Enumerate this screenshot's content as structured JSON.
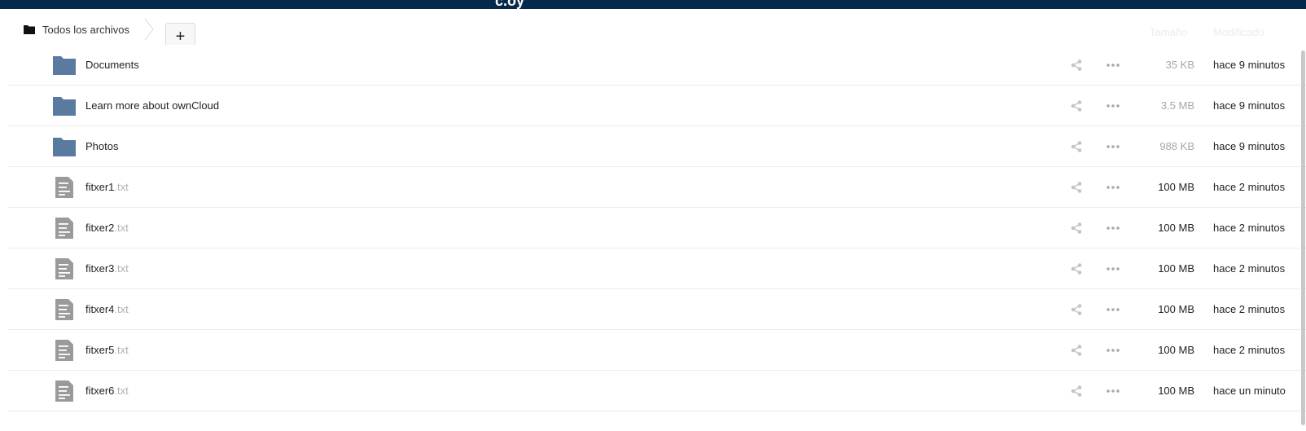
{
  "header": {
    "logo_fragment": "c.oy"
  },
  "breadcrumb": {
    "root_label": "Todos los archivos"
  },
  "toolbar": {
    "add_label": "+"
  },
  "columns": {
    "size": "Tamaño",
    "modified": "Modificado"
  },
  "files": [
    {
      "name": "Documents",
      "ext": "",
      "type": "folder",
      "size": "35 KB",
      "size_color": "#a7a7a7",
      "modified": "hace 9 minutos"
    },
    {
      "name": "Learn more about ownCloud",
      "ext": "",
      "type": "folder",
      "size": "3.5 MB",
      "size_color": "#a7a7a7",
      "modified": "hace 9 minutos"
    },
    {
      "name": "Photos",
      "ext": "",
      "type": "folder",
      "size": "988 KB",
      "size_color": "#a7a7a7",
      "modified": "hace 9 minutos"
    },
    {
      "name": "fitxer1",
      "ext": ".txt",
      "type": "file",
      "size": "100 MB",
      "size_color": "#222222",
      "modified": "hace 2 minutos"
    },
    {
      "name": "fitxer2",
      "ext": ".txt",
      "type": "file",
      "size": "100 MB",
      "size_color": "#222222",
      "modified": "hace 2 minutos"
    },
    {
      "name": "fitxer3",
      "ext": ".txt",
      "type": "file",
      "size": "100 MB",
      "size_color": "#222222",
      "modified": "hace 2 minutos"
    },
    {
      "name": "fitxer4",
      "ext": ".txt",
      "type": "file",
      "size": "100 MB",
      "size_color": "#222222",
      "modified": "hace 2 minutos"
    },
    {
      "name": "fitxer5",
      "ext": ".txt",
      "type": "file",
      "size": "100 MB",
      "size_color": "#222222",
      "modified": "hace 2 minutos"
    },
    {
      "name": "fitxer6",
      "ext": ".txt",
      "type": "file",
      "size": "100 MB",
      "size_color": "#222222",
      "modified": "hace un minuto"
    }
  ],
  "colors": {
    "header_bg": "#04294b",
    "folder_icon": "#5b7aa0",
    "file_icon": "#9a9a9a",
    "action_icon": "#c4c4c4"
  }
}
